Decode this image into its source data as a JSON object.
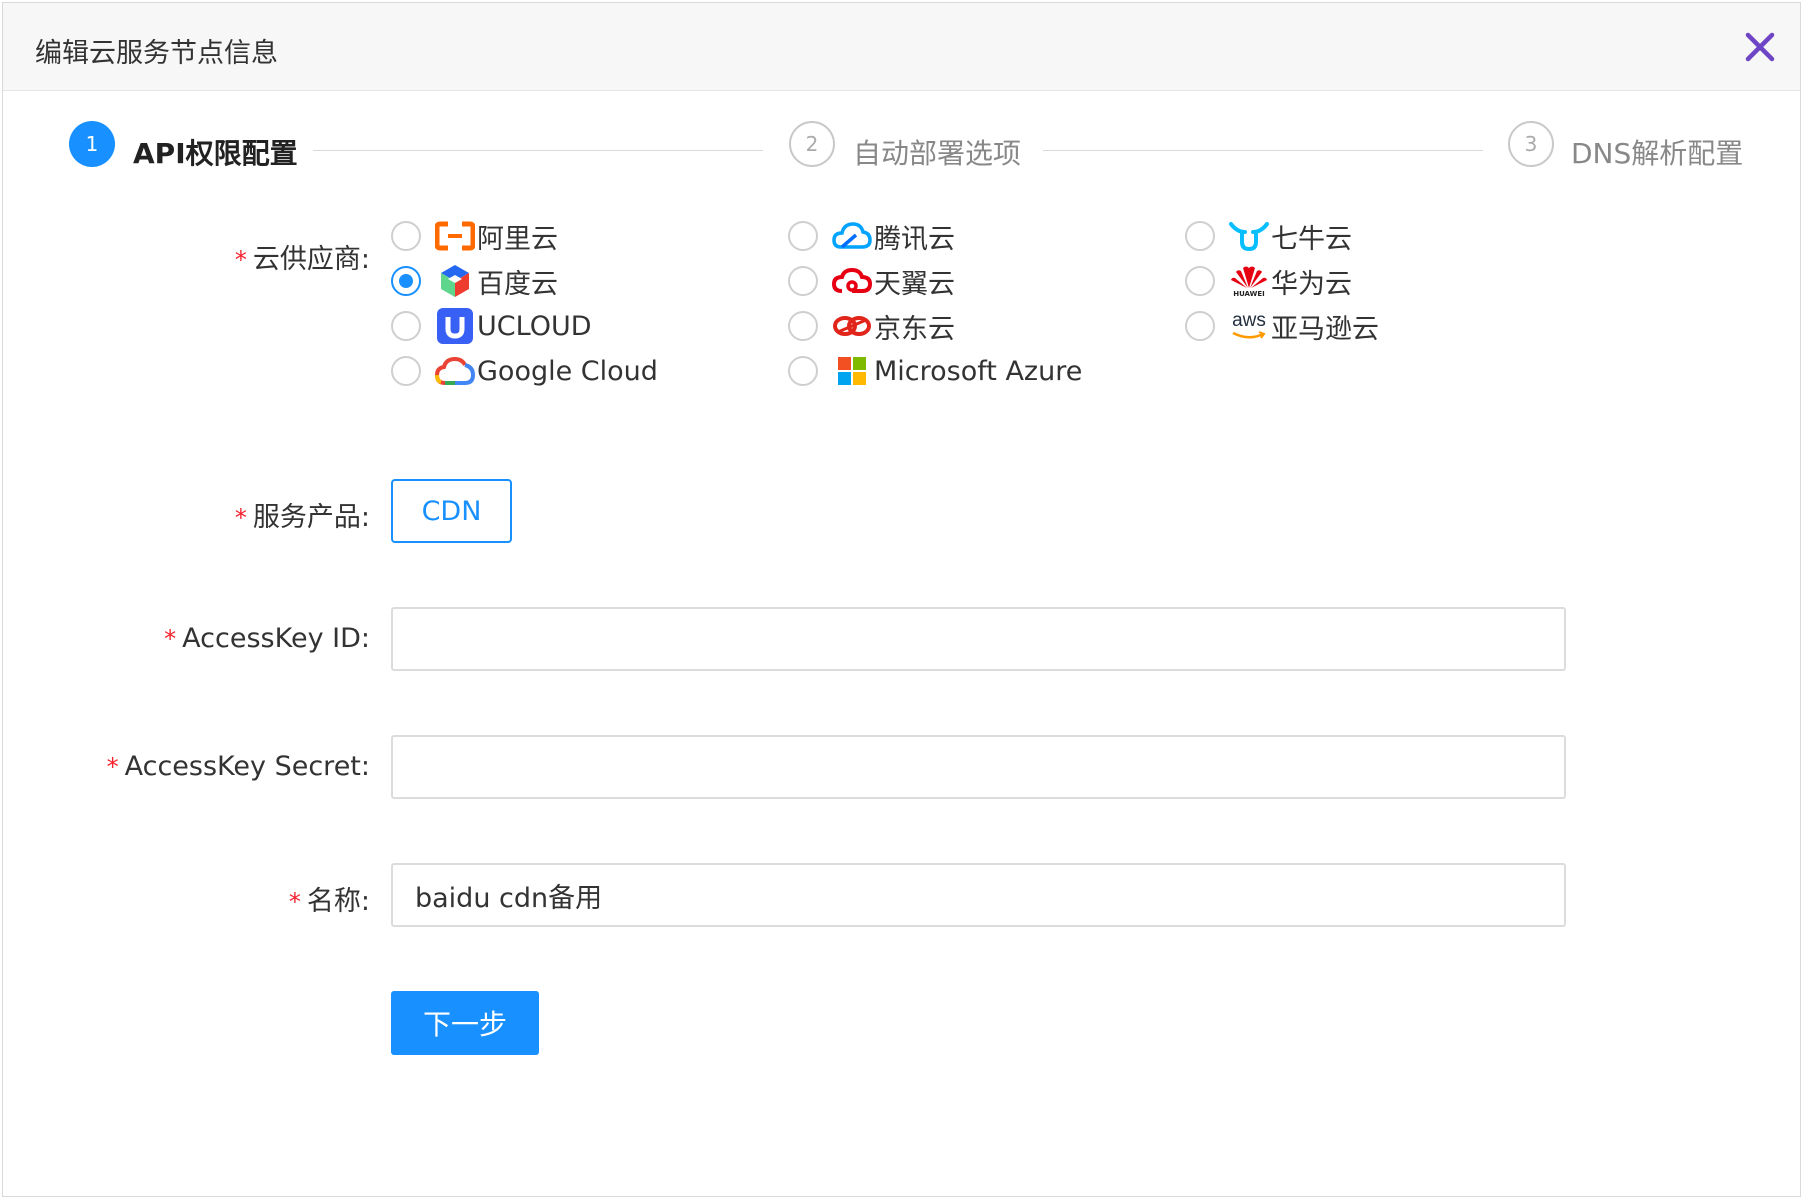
{
  "dialog": {
    "title": "编辑云服务节点信息"
  },
  "steps": [
    {
      "number": "1",
      "label": "API权限配置",
      "state": "active"
    },
    {
      "number": "2",
      "label": "自动部署选项",
      "state": "wait"
    },
    {
      "number": "3",
      "label": "DNS解析配置",
      "state": "wait"
    }
  ],
  "form": {
    "required_mark": "*",
    "provider_label": "云供应商:",
    "providers": [
      {
        "name": "阿里云",
        "icon": "aliyun-logo",
        "checked": false
      },
      {
        "name": "腾讯云",
        "icon": "tencent-cloud-logo",
        "checked": false
      },
      {
        "name": "七牛云",
        "icon": "qiniu-logo",
        "checked": false
      },
      {
        "name": "百度云",
        "icon": "baidu-cloud-logo",
        "checked": true
      },
      {
        "name": "天翼云",
        "icon": "ctyun-logo",
        "checked": false
      },
      {
        "name": "华为云",
        "icon": "huawei-logo",
        "checked": false
      },
      {
        "name": "UCLOUD",
        "icon": "ucloud-logo",
        "checked": false
      },
      {
        "name": "京东云",
        "icon": "jd-cloud-logo",
        "checked": false
      },
      {
        "name": "亚马逊云",
        "icon": "aws-logo",
        "checked": false
      },
      {
        "name": "Google Cloud",
        "icon": "google-cloud-logo",
        "checked": false
      },
      {
        "name": "Microsoft Azure",
        "icon": "microsoft-logo",
        "checked": false
      }
    ],
    "huawei_logo_text": "HUAWEI",
    "aws_logo_text": "aws",
    "product_label": "服务产品:",
    "product_value": "CDN",
    "access_key_id_label": "AccessKey ID:",
    "access_key_id_value": "",
    "access_key_secret_label": "AccessKey Secret:",
    "access_key_secret_value": "",
    "name_label": "名称:",
    "name_value": "baidu cdn备用",
    "next_button": "下一步"
  },
  "colors": {
    "primary": "#1890ff",
    "close_icon": "#6e45c4",
    "required": "#f5222d"
  }
}
